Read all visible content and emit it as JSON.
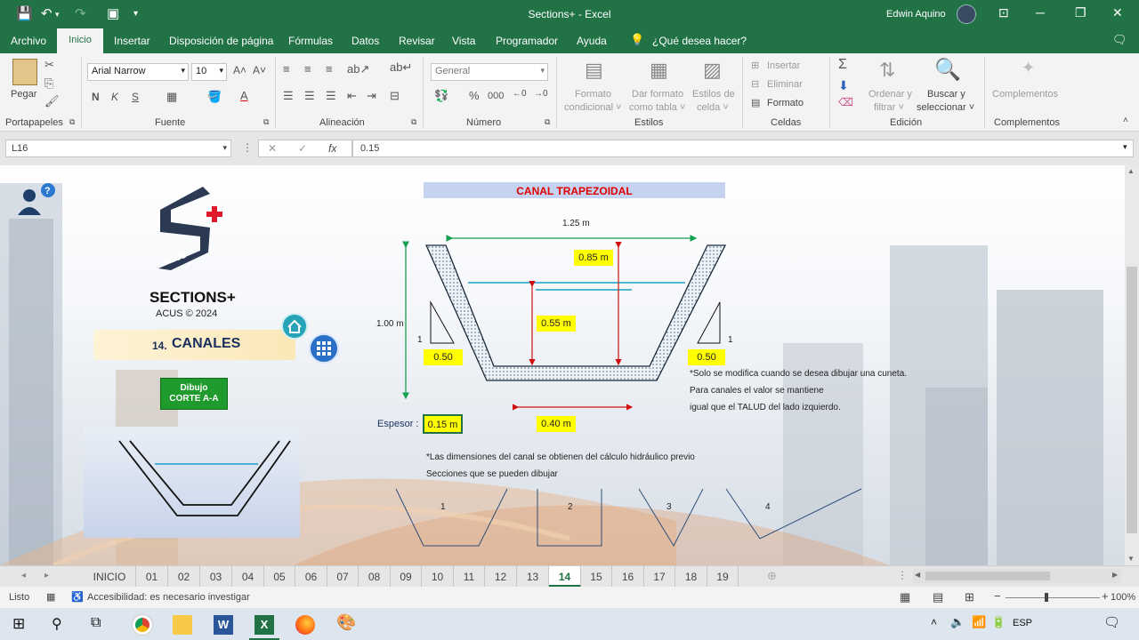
{
  "title_bar": {
    "title": "Sections+  -  Excel",
    "user": "Edwin Aquino"
  },
  "menu": {
    "tabs": [
      "Archivo",
      "Inicio",
      "Insertar",
      "Disposición de página",
      "Fórmulas",
      "Datos",
      "Revisar",
      "Vista",
      "Programador",
      "Ayuda"
    ],
    "tell_me": "¿Qué desea hacer?"
  },
  "ribbon": {
    "paste": "Pegar",
    "font_name": "Arial Narrow",
    "font_size": "10",
    "bold": "N",
    "italic": "K",
    "underline": "S",
    "number_format": "General",
    "conditional_format": [
      "Formato",
      "condicional ˅"
    ],
    "format_table": [
      "Dar formato",
      "como tabla ˅"
    ],
    "cell_styles": [
      "Estilos de",
      "celda ˅"
    ],
    "insert": "Insertar",
    "delete": "Eliminar",
    "format": "Formato",
    "sort": [
      "Ordenar y",
      "filtrar ˅"
    ],
    "find": [
      "Buscar y",
      "seleccionar ˅"
    ],
    "addins": "Complementos",
    "groups": [
      "Portapapeles",
      "Fuente",
      "Alineación",
      "Número",
      "Estilos",
      "Celdas",
      "Edición",
      "Complementos"
    ]
  },
  "formula_bar": {
    "name_box": "L16",
    "value": "0.15"
  },
  "sheet": {
    "logo_name": "SECTIONS+",
    "logo_sub": "ACUS © 2024",
    "logo_badge": "ACUS",
    "section_num": "14.",
    "section_title": "CANALES",
    "draw_button": [
      "Dibujo",
      "CORTE A-A"
    ],
    "header": "CANAL TRAPEZOIDAL",
    "dims": {
      "top_width": "1.25 m",
      "freeboard": "0.85 m",
      "height": "1.00 m",
      "depth": "0.55 m",
      "slope_left": "0.50",
      "slope_right": "0.50",
      "slope_one": "1",
      "thickness_label": "Espesor :",
      "thickness": "0.15 m",
      "bottom_width": "0.40 m"
    },
    "notes": {
      "right": [
        "*Solo se modifica cuando se desea dibujar una cuneta.",
        "Para canales el valor se mantiene",
        "igual que el TALUD del lado izquierdo."
      ],
      "bottom": [
        "*Las dimensiones del canal se obtienen del cálculo hidráulico previo",
        "Secciones que se pueden dibujar"
      ]
    },
    "sections": [
      "1",
      "2",
      "3",
      "4"
    ]
  },
  "sheet_tabs": [
    "INICIO",
    "01",
    "02",
    "03",
    "04",
    "05",
    "06",
    "07",
    "08",
    "09",
    "10",
    "11",
    "12",
    "13",
    "14",
    "15",
    "16",
    "17",
    "18",
    "19"
  ],
  "active_sheet": "14",
  "status": {
    "ready": "Listo",
    "accessibility": "Accesibilidad: es necesario investigar",
    "zoom": "100%"
  },
  "taskbar": {
    "lang": "ESP"
  },
  "colors": {
    "excel_green": "#217346",
    "highlight": "#ffff00",
    "header_bg": "#c5d3f0",
    "title_red": "#e00000"
  }
}
